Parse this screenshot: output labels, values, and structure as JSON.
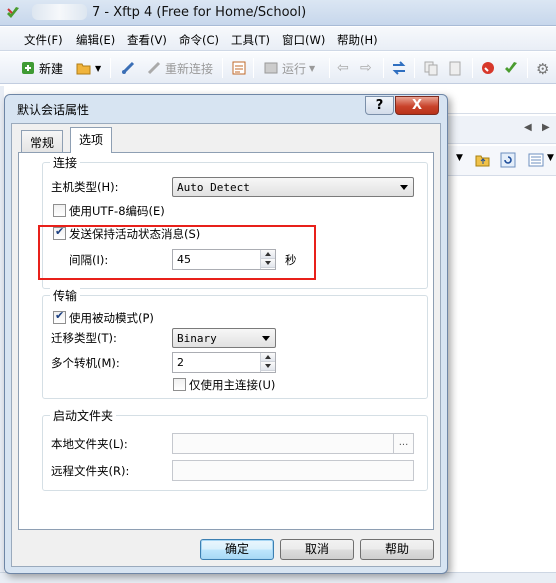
{
  "window": {
    "title": "7 - Xftp 4 (Free for Home/School)"
  },
  "menu": {
    "items": [
      "文件(F)",
      "编辑(E)",
      "查看(V)",
      "命令(C)",
      "工具(T)",
      "窗口(W)",
      "帮助(H)"
    ]
  },
  "toolbar": {
    "new_label": "新建",
    "reconnect_label": "重新连接",
    "run_label": "运行"
  },
  "dialog": {
    "title": "默认会话属性",
    "help_button": "?",
    "close_button": "X",
    "tabs": [
      "常规",
      "选项"
    ],
    "active_tab": "选项",
    "connection": {
      "legend": "连接",
      "host_type_label": "主机类型(H):",
      "host_type_value": "Auto Detect",
      "utf8_label": "使用UTF-8编码(E)",
      "utf8_checked": false,
      "keepalive_label": "发送保持活动状态消息(S)",
      "keepalive_checked": true,
      "interval_label": "间隔(I):",
      "interval_value": "45",
      "interval_unit": "秒"
    },
    "transfer": {
      "legend": "传输",
      "passive_label": "使用被动模式(P)",
      "passive_checked": true,
      "transfer_type_label": "迁移类型(T):",
      "transfer_type_value": "Binary",
      "multi_relay_label": "多个转机(M):",
      "multi_relay_value": "2",
      "primary_only_label": "仅使用主连接(U)",
      "primary_only_checked": false
    },
    "startup_folder": {
      "legend": "启动文件夹",
      "local_label": "本地文件夹(L):",
      "local_value": "",
      "browse_label": "...",
      "remote_label": "远程文件夹(R):",
      "remote_value": ""
    },
    "buttons": {
      "ok": "确定",
      "cancel": "取消",
      "help": "帮助"
    }
  },
  "colors": {
    "highlight_border": "#e8201a",
    "dialog_frame": "#d7e4f2",
    "close_button": "#c9432b"
  }
}
